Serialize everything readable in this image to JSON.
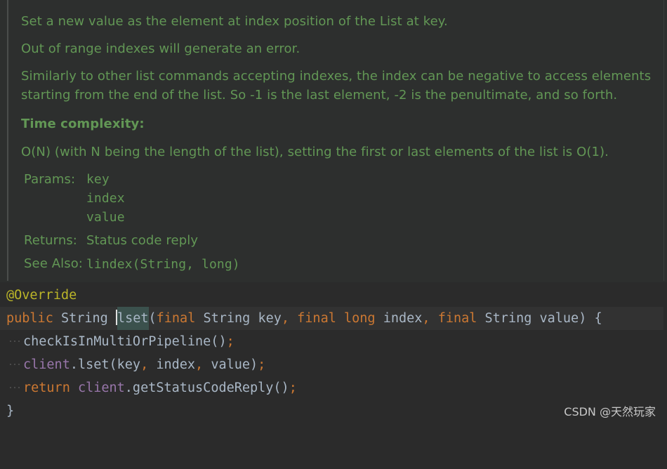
{
  "doc": {
    "line1": "Set a new value as the element at index position of the List at key.",
    "line2": "Out of range indexes will generate an error.",
    "line3a": "Similarly to other list commands accepting indexes, the index can be negative to access elements",
    "line3b": "starting from the end of the list. So -1 is the last element, -2 is the penultimate, and so forth.",
    "complexity_heading": "Time complexity:",
    "complexity_text": "O(N) (with N being the length of the list), setting the first or last elements of the list is O(1).",
    "params_label": "Params:",
    "params": [
      "key",
      "index",
      "value"
    ],
    "returns_label": "Returns:",
    "returns_text": "Status code reply",
    "see_also_label": "See Also:",
    "see_also_link": "lindex(String, long)"
  },
  "code": {
    "annotation": "@Override",
    "sig_public": "public",
    "sig_type1": "String",
    "sig_method": "lset",
    "sig_open": "(",
    "sig_final1": "final",
    "sig_type2": "String",
    "sig_key": "key",
    "sig_comma1": ",",
    "sig_final2": "final",
    "sig_long": "long",
    "sig_index": "index",
    "sig_comma2": ",",
    "sig_final3": "final",
    "sig_type3": "String",
    "sig_value": "value",
    "sig_close": ") {",
    "l3_call": "checkIsInMultiOrPipeline()",
    "l3_semi": ";",
    "l4_client": "client",
    "l4_call": ".lset(key",
    "l4_c1": ",",
    "l4_index": " index",
    "l4_c2": ",",
    "l4_rest": " value)",
    "l4_semi": ";",
    "l5_return": "return",
    "l5_client": "client",
    "l5_call": ".getStatusCodeReply()",
    "l5_semi": ";",
    "close_brace": "}"
  },
  "watermark": "CSDN @天然玩家"
}
